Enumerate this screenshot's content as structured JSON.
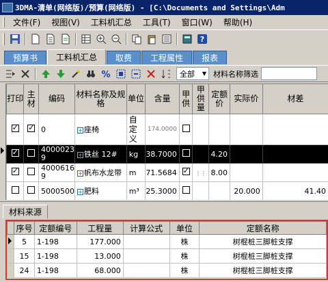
{
  "window": {
    "title": "3DMA-清单(网络版)/预算(网络版) - [C:\\Documents and Settings\\Adm"
  },
  "menu": [
    "文件(F)",
    "视图(V)",
    "工料机汇总",
    "工具(T)",
    "窗口(W)",
    "帮助(H)"
  ],
  "tabs": [
    "预算书",
    "工料机汇总",
    "取费",
    "工程属性",
    "报表"
  ],
  "active_tab": 1,
  "toolbar2": {
    "scope_value": "全部",
    "filter_label": "材料名称筛选",
    "filter_value": ""
  },
  "grid1": {
    "headers": [
      "打印",
      "主材",
      "编码",
      "材料名称及规格",
      "单位",
      "含量",
      "甲供",
      "甲供量",
      "定额价",
      "实际价",
      "材差"
    ],
    "rows": [
      {
        "print": true,
        "main": true,
        "code": "0",
        "name": "座椅",
        "unit": "自定义",
        "qty": "174.0000",
        "jg": false,
        "jgl": "",
        "price": "",
        "actual": "",
        "diff": ""
      },
      {
        "print": true,
        "main": false,
        "code": "40000239",
        "name": "铁丝 12#",
        "unit": "kg",
        "qty": "38.7000",
        "jg": false,
        "jgl": "",
        "price": "4.20",
        "actual": "",
        "diff": ""
      },
      {
        "print": true,
        "main": false,
        "code": "40006169",
        "name": "帆布水龙带",
        "unit": "m",
        "qty": "71.5684",
        "jg": true,
        "jgl": "",
        "price": "8.00",
        "actual": "",
        "diff": ""
      },
      {
        "print": false,
        "main": false,
        "code": "5000500",
        "name": "肥料",
        "unit": "m³",
        "qty": "25.3000",
        "jg": false,
        "jgl": "",
        "price": "",
        "actual": "20.000",
        "diff": "41.40"
      }
    ]
  },
  "lower": {
    "tab": "材料来源",
    "headers": [
      "序号",
      "定额编号",
      "工程量",
      "计算公式",
      "单位",
      "定额名称"
    ],
    "rows": [
      {
        "no": "5",
        "code": "1-198",
        "qty": "177.000",
        "formula": "",
        "unit": "株",
        "name": "树棍桩三脚桩支撑"
      },
      {
        "no": "15",
        "code": "1-198",
        "qty": "13.000",
        "formula": "",
        "unit": "株",
        "name": "树棍桩三脚桩支撑"
      },
      {
        "no": "24",
        "code": "1-198",
        "qty": "68.000",
        "formula": "",
        "unit": "株",
        "name": "树棍桩三脚桩支撑"
      }
    ]
  },
  "icons": [
    "save-icon",
    "new-icon",
    "open-icon",
    "grid-icon",
    "zoom-in-icon",
    "zoom-out-icon",
    "copy-icon",
    "paste-icon",
    "calculator-icon",
    "help-icon"
  ]
}
